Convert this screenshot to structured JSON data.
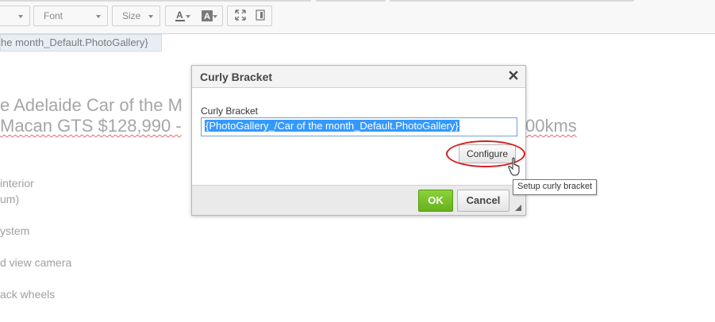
{
  "toolbar": {
    "font_label": "Font",
    "size_label": "Size",
    "text_color_icon": "text-color-icon",
    "bg_color_icon": "background-color-icon",
    "maximize_icon": "maximize-icon",
    "show_blocks_icon": "show-blocks-icon"
  },
  "editor": {
    "tag_text": "he month_Default.PhotoGallery}",
    "heading_line1": "e Adelaide Car of the M",
    "heading_line2_left": "Macan GTS $128,990 -",
    "heading_line2_right": "00kms",
    "bullets": [
      "interior",
      "um)",
      "ystem",
      "d view camera",
      "ack wheels"
    ]
  },
  "dialog": {
    "title": "Curly Bracket",
    "field_label": "Curly Bracket",
    "field_value": "{PhotoGallery_/Car of the month_Default.PhotoGallery}",
    "configure_label": "Configure",
    "ok_label": "OK",
    "cancel_label": "Cancel",
    "tooltip": "Setup curly bracket"
  },
  "colors": {
    "ok_green": "#76c02a",
    "highlight_red": "#d21f1f",
    "selection_blue": "#3399ff"
  }
}
